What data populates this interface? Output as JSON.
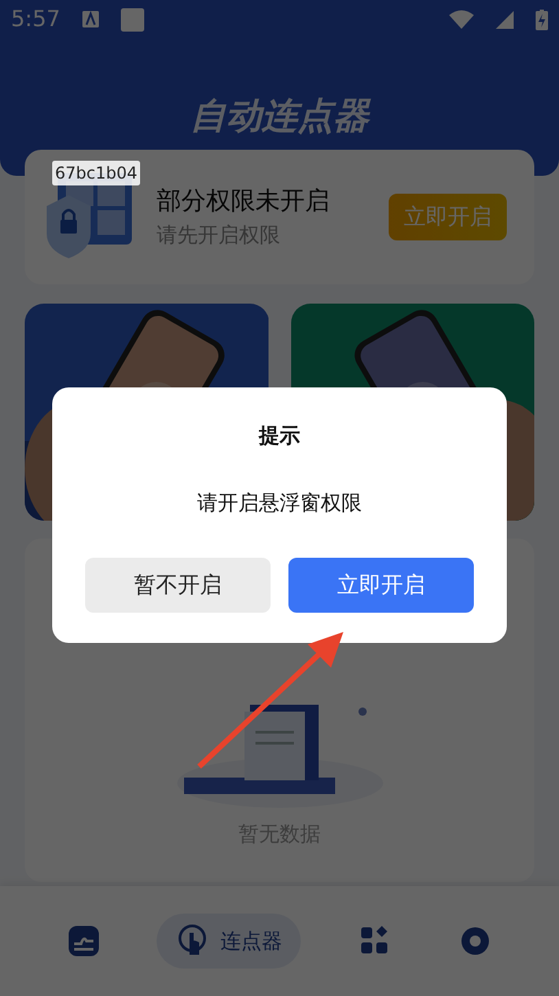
{
  "status_bar": {
    "time": "5:57"
  },
  "header": {
    "title": "自动连点器"
  },
  "permission_card": {
    "code": "67bc1b04",
    "title": "部分权限未开启",
    "subtitle": "请先开启权限",
    "button": "立即开启"
  },
  "empty_state": {
    "text": "暂无数据"
  },
  "bottom_nav": [
    {
      "selected": false
    },
    {
      "selected": true,
      "label": "连点器"
    },
    {
      "selected": false
    },
    {
      "selected": false
    }
  ],
  "dialog": {
    "title": "提示",
    "message": "请开启悬浮窗权限",
    "buttons": [
      {
        "label": "暂不开启",
        "kind": "secondary"
      },
      {
        "label": "立即开启",
        "kind": "primary"
      }
    ]
  }
}
